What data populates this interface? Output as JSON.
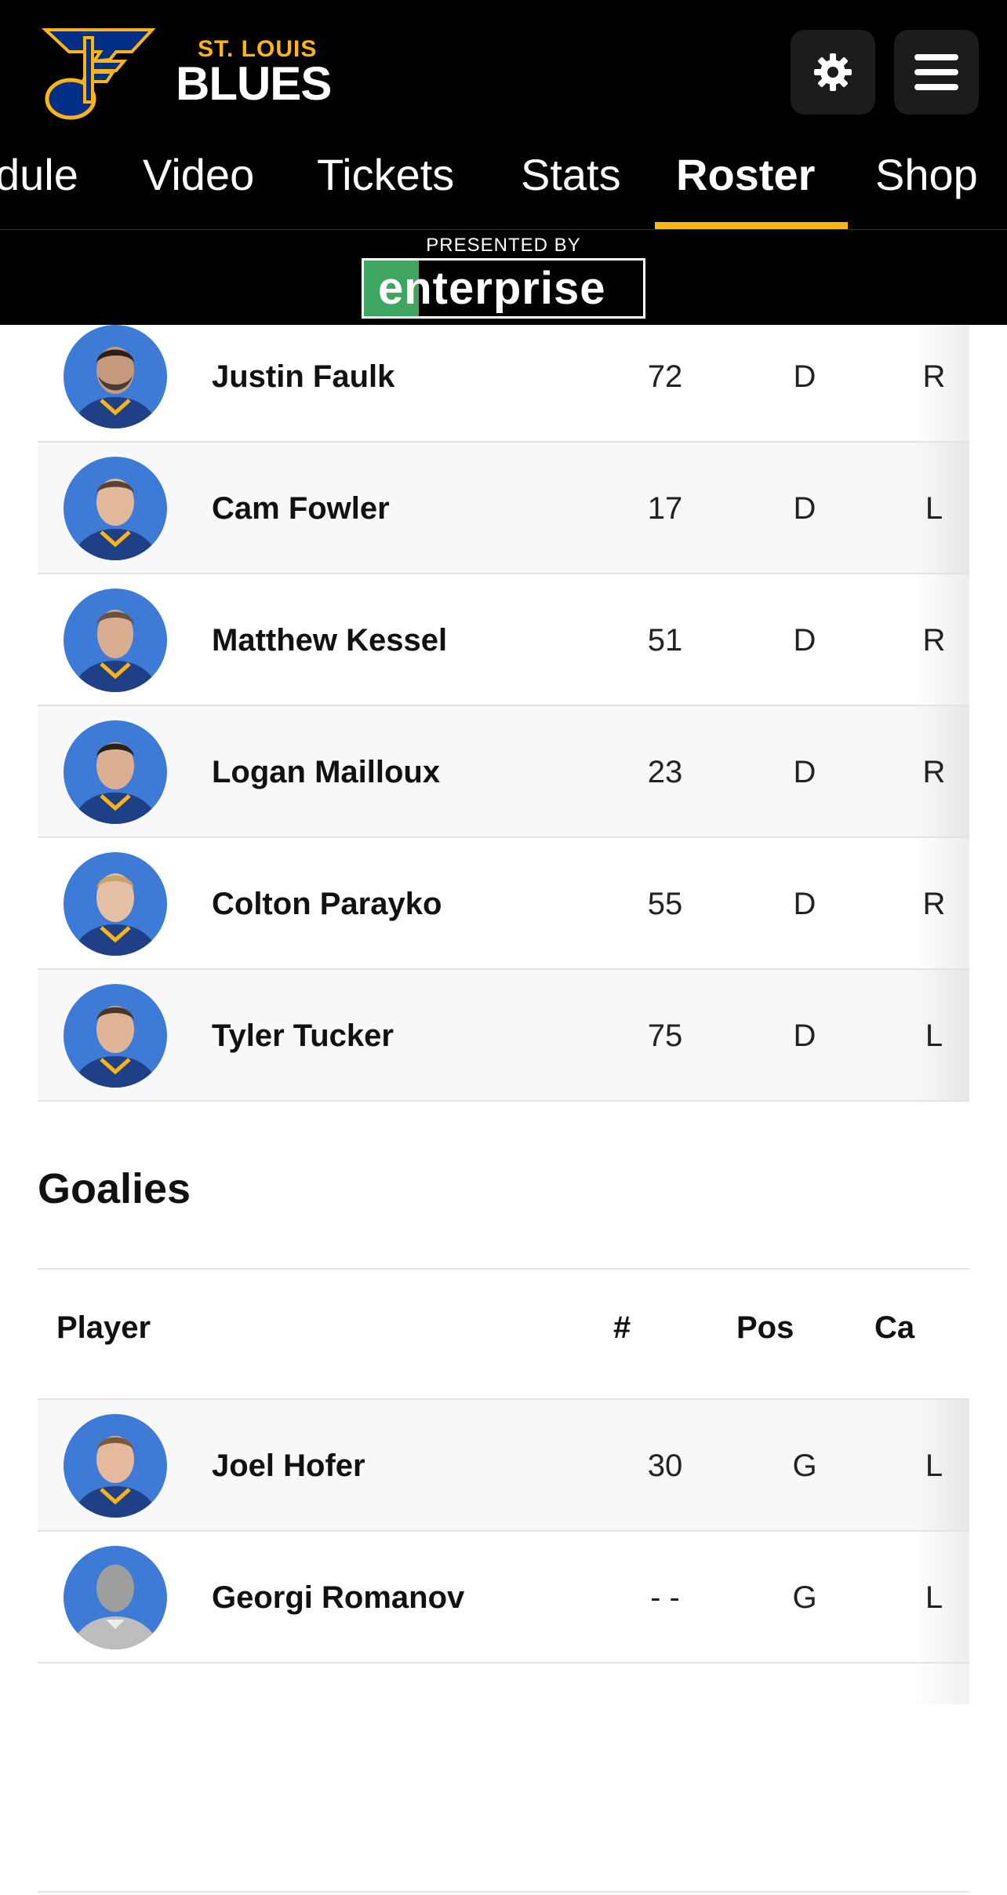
{
  "header": {
    "logo_city": "ST. LOUIS",
    "logo_name": "BLUES",
    "settings_icon": "gear-icon",
    "menu_icon": "hamburger-menu-icon",
    "brand_colors": {
      "gold": "#FCB514",
      "blue": "#002F87",
      "background": "#000000"
    }
  },
  "nav": {
    "items": [
      {
        "label": "dule",
        "active": false
      },
      {
        "label": "Video",
        "active": false
      },
      {
        "label": "Tickets",
        "active": false
      },
      {
        "label": "Stats",
        "active": false
      },
      {
        "label": "Roster",
        "active": true
      },
      {
        "label": "Shop",
        "active": false
      }
    ]
  },
  "sponsor": {
    "presented_by": "PRESENTED BY",
    "name": "enterprise"
  },
  "defense": {
    "rows": [
      {
        "name": "Justin Faulk",
        "number": "72",
        "pos": "D",
        "cap": "R"
      },
      {
        "name": "Cam Fowler",
        "number": "17",
        "pos": "D",
        "cap": "L"
      },
      {
        "name": "Matthew Kessel",
        "number": "51",
        "pos": "D",
        "cap": "R"
      },
      {
        "name": "Logan Mailloux",
        "number": "23",
        "pos": "D",
        "cap": "R"
      },
      {
        "name": "Colton Parayko",
        "number": "55",
        "pos": "D",
        "cap": "R"
      },
      {
        "name": "Tyler Tucker",
        "number": "75",
        "pos": "D",
        "cap": "L"
      }
    ]
  },
  "goalies": {
    "title": "Goalies",
    "columns": {
      "player": "Player",
      "number": "#",
      "pos": "Pos",
      "cap": "Ca"
    },
    "rows": [
      {
        "name": "Joel Hofer",
        "number": "30",
        "pos": "G",
        "cap": "L"
      },
      {
        "name": "Georgi Romanov",
        "number": "- -",
        "pos": "G",
        "cap": "L"
      }
    ]
  }
}
